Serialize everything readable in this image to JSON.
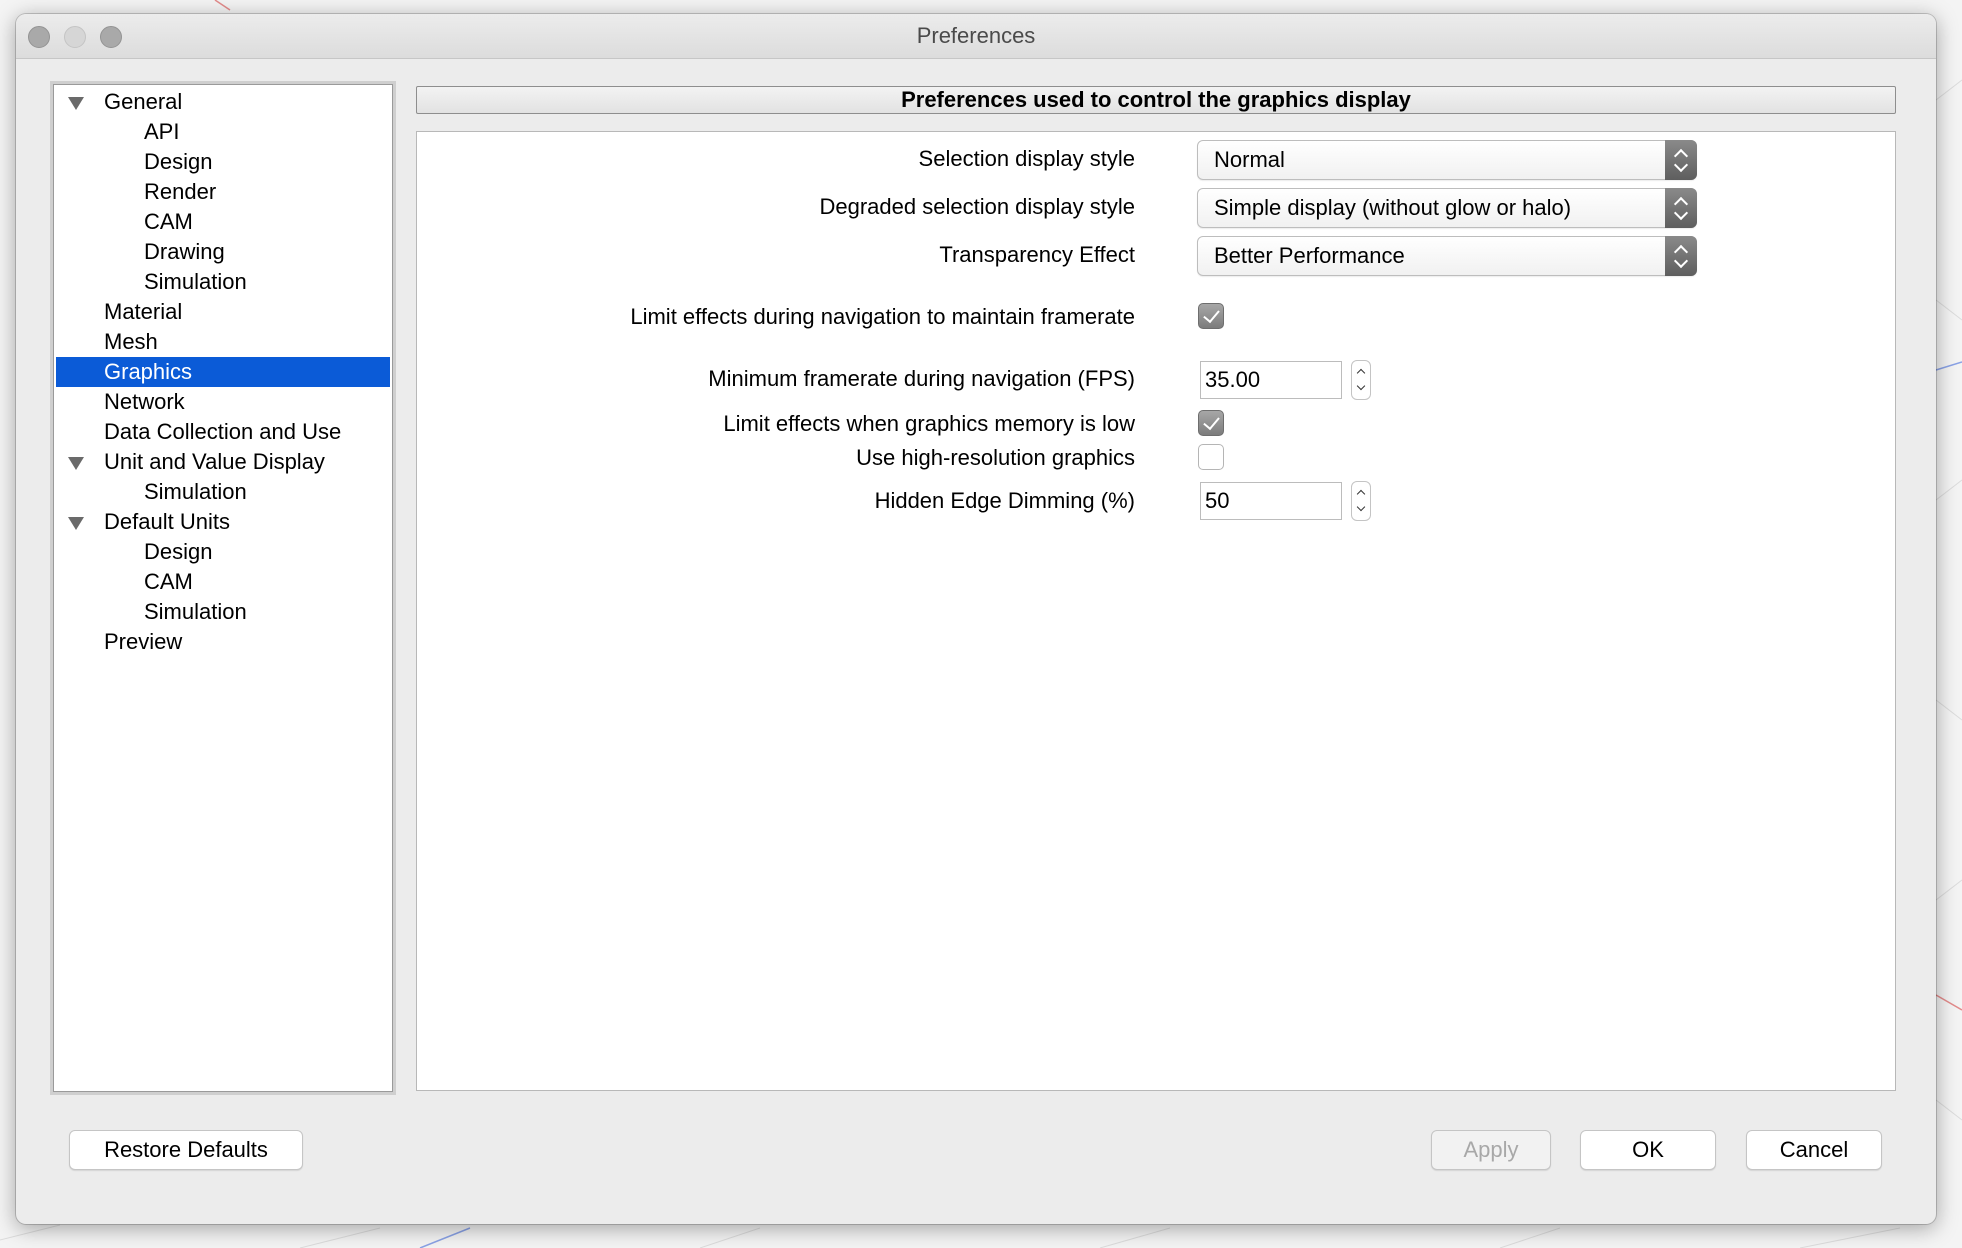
{
  "window": {
    "title": "Preferences"
  },
  "tree": [
    {
      "label": "General",
      "level": 0,
      "expanded": true
    },
    {
      "label": "API",
      "level": 1
    },
    {
      "label": "Design",
      "level": 1
    },
    {
      "label": "Render",
      "level": 1
    },
    {
      "label": "CAM",
      "level": 1
    },
    {
      "label": "Drawing",
      "level": 1
    },
    {
      "label": "Simulation",
      "level": 1
    },
    {
      "label": "Material",
      "level": 0
    },
    {
      "label": "Mesh",
      "level": 0
    },
    {
      "label": "Graphics",
      "level": 0,
      "selected": true
    },
    {
      "label": "Network",
      "level": 0
    },
    {
      "label": "Data Collection and Use",
      "level": 0
    },
    {
      "label": "Unit and Value Display",
      "level": 0,
      "expanded": true
    },
    {
      "label": "Simulation",
      "level": 1
    },
    {
      "label": "Default Units",
      "level": 0,
      "expanded": true
    },
    {
      "label": "Design",
      "level": 1
    },
    {
      "label": "CAM",
      "level": 1
    },
    {
      "label": "Simulation",
      "level": 1
    },
    {
      "label": "Preview",
      "level": 0
    }
  ],
  "panel": {
    "header": "Preferences used to control the graphics display",
    "selection_style": {
      "label": "Selection display style",
      "value": "Normal"
    },
    "degraded_style": {
      "label": "Degraded selection display style",
      "value": "Simple display (without glow or halo)"
    },
    "transparency": {
      "label": "Transparency Effect",
      "value": "Better Performance"
    },
    "limit_nav": {
      "label": "Limit effects during navigation to maintain framerate",
      "checked": true
    },
    "min_fps": {
      "label": "Minimum framerate during navigation (FPS)",
      "value": "35.00"
    },
    "limit_memory": {
      "label": "Limit effects when graphics memory is low",
      "checked": true
    },
    "high_res": {
      "label": "Use high-resolution graphics",
      "checked": false
    },
    "edge_dimming": {
      "label": "Hidden Edge Dimming (%)",
      "value": "50"
    }
  },
  "buttons": {
    "restore": "Restore Defaults",
    "apply": "Apply",
    "ok": "OK",
    "cancel": "Cancel"
  },
  "colors": {
    "selection": "#0b5bd7",
    "window_bg": "#ececec"
  }
}
